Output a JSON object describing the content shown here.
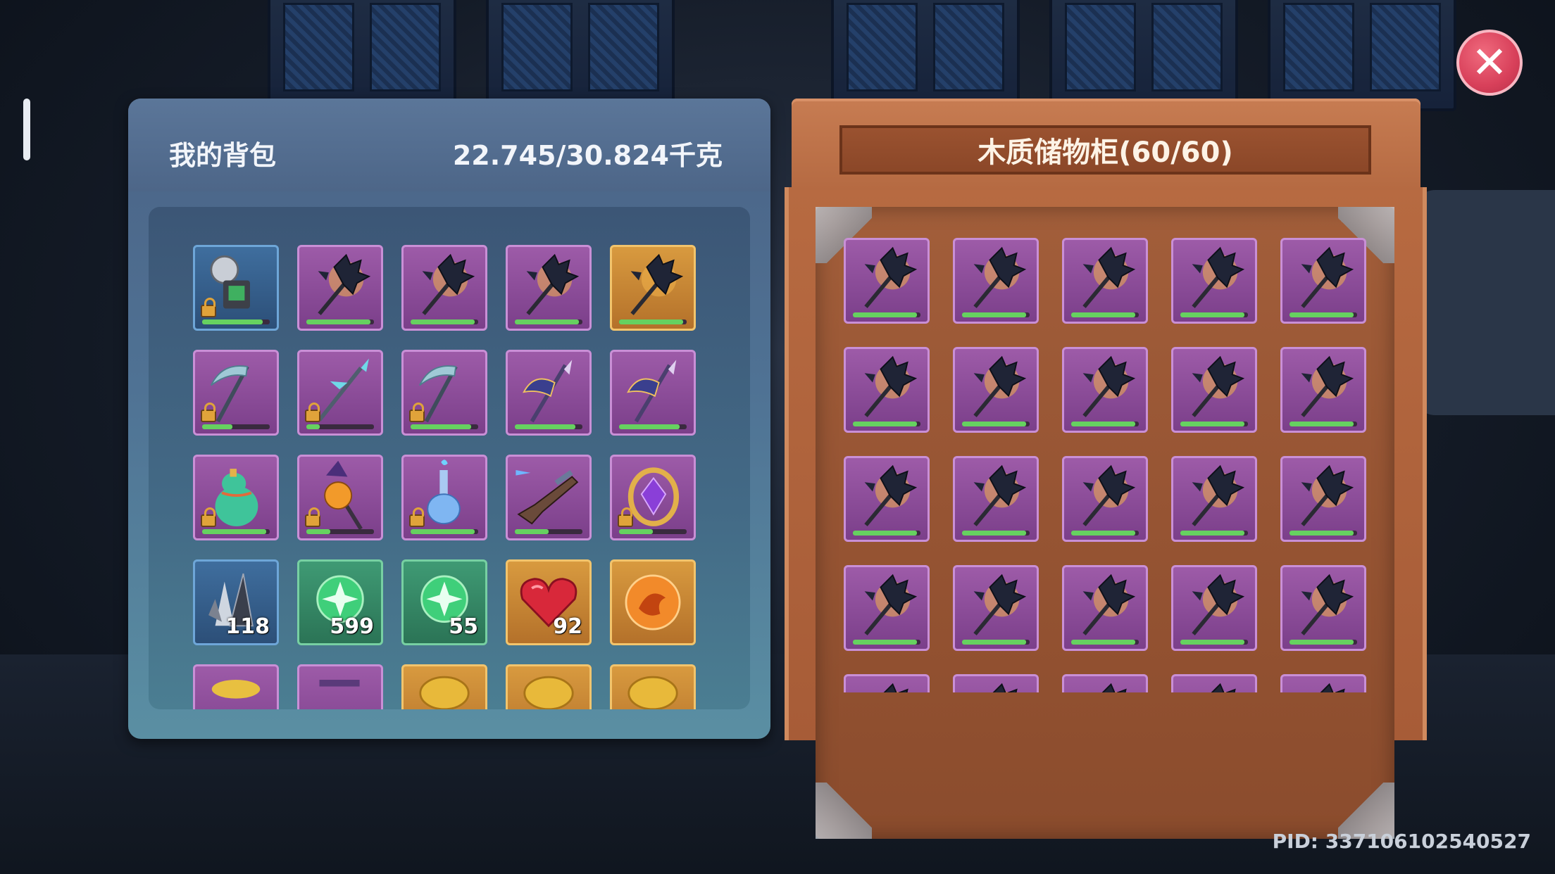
{
  "bag": {
    "title": "我的背包",
    "weight": "22.745/30.824千克",
    "items": [
      {
        "name": "microphone-item",
        "rarity": "blue",
        "icon": "microphone-icon",
        "locked": true,
        "durability": 0.9
      },
      {
        "name": "bat-axe-item",
        "rarity": "purple",
        "icon": "bat-axe-icon",
        "locked": false,
        "durability": 0.95
      },
      {
        "name": "bat-axe-item",
        "rarity": "purple",
        "icon": "bat-axe-icon",
        "locked": false,
        "durability": 0.95
      },
      {
        "name": "bat-axe-item",
        "rarity": "purple",
        "icon": "bat-axe-icon",
        "locked": false,
        "durability": 0.95
      },
      {
        "name": "bat-axe-item",
        "rarity": "gold",
        "icon": "bat-axe-icon",
        "locked": false,
        "durability": 0.95
      },
      {
        "name": "scythe-item",
        "rarity": "purple",
        "icon": "scythe-icon",
        "locked": true,
        "durability": 0.45
      },
      {
        "name": "crystal-spear-item",
        "rarity": "purple",
        "icon": "spear-icon",
        "locked": true,
        "durability": 0.2
      },
      {
        "name": "scythe-item",
        "rarity": "purple",
        "icon": "scythe-icon",
        "locked": true,
        "durability": 0.9
      },
      {
        "name": "battle-axe-item",
        "rarity": "purple",
        "icon": "double-axe-icon",
        "locked": false,
        "durability": 0.9
      },
      {
        "name": "battle-axe-item",
        "rarity": "purple",
        "icon": "double-axe-icon",
        "locked": false,
        "durability": 0.9
      },
      {
        "name": "green-gourd-item",
        "rarity": "purple",
        "icon": "gourd-icon",
        "locked": true,
        "durability": 0.95
      },
      {
        "name": "pumpkin-staff-item",
        "rarity": "purple",
        "icon": "pumpkin-staff-icon",
        "locked": true,
        "durability": 0.35
      },
      {
        "name": "potion-bottle-item",
        "rarity": "purple",
        "icon": "potion-icon",
        "locked": true,
        "durability": 0.95
      },
      {
        "name": "rifle-item",
        "rarity": "purple",
        "icon": "rifle-icon",
        "locked": false,
        "durability": 0.5
      },
      {
        "name": "amulet-item",
        "rarity": "purple",
        "icon": "amulet-icon",
        "locked": true,
        "durability": 0.5
      },
      {
        "name": "crystal-shard-item",
        "rarity": "blue",
        "icon": "crystal-icon",
        "count": "118"
      },
      {
        "name": "green-orb-item",
        "rarity": "green",
        "icon": "green-orb-icon",
        "count": "599"
      },
      {
        "name": "green-orb-item",
        "rarity": "green",
        "icon": "green-orb-icon",
        "count": "55"
      },
      {
        "name": "red-heart-item",
        "rarity": "gold",
        "icon": "heart-gem-icon",
        "count": "92"
      },
      {
        "name": "fire-orb-item",
        "rarity": "gold",
        "icon": "fire-orb-icon"
      },
      {
        "name": "partial-item",
        "rarity": "purple",
        "icon": "gold-pile-icon"
      },
      {
        "name": "partial-item",
        "rarity": "purple",
        "icon": "unknown-icon"
      },
      {
        "name": "partial-item",
        "rarity": "gold",
        "icon": "coin-icon"
      },
      {
        "name": "partial-item",
        "rarity": "gold",
        "icon": "coin-icon"
      },
      {
        "name": "partial-item",
        "rarity": "gold",
        "icon": "coin-icon"
      }
    ]
  },
  "cabinet": {
    "title": "木质储物柜(60/60)",
    "item_icon": "bat-axe-icon",
    "durability": 0.95,
    "visible_rows": 5
  },
  "pid": "PID: 337106102540527",
  "close_icon": "close-icon",
  "colors": {
    "bag_panel": "#4f7294",
    "cabinet_wood": "#b56a42",
    "close_button": "#d8405a",
    "durability_fill": "#66d160"
  }
}
